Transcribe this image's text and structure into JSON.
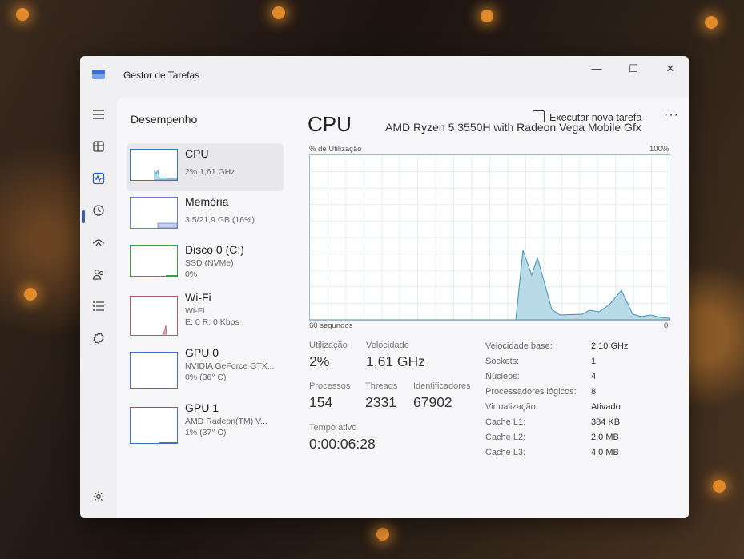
{
  "window": {
    "title": "Gestor de Tarefas",
    "controls": {
      "minimize": "—",
      "maximize": "☐",
      "close": "✕"
    }
  },
  "toolbar": {
    "page_title": "Desempenho",
    "run_task": "Executar nova tarefa",
    "more": "···"
  },
  "rail": {
    "icons": [
      "menu-icon",
      "processes-icon",
      "performance-icon",
      "app-history-icon",
      "startup-apps-icon",
      "users-icon",
      "details-icon",
      "services-icon",
      "settings-icon"
    ],
    "selected": "performance-icon"
  },
  "list": {
    "items": [
      {
        "name": "CPU",
        "lines": [
          "2% 1,61 GHz"
        ]
      },
      {
        "name": "Memória",
        "lines": [
          "3,5/21,9 GB (16%)"
        ]
      },
      {
        "name": "Disco 0 (C:)",
        "lines": [
          "SSD (NVMe)",
          "0%"
        ]
      },
      {
        "name": "Wi-Fi",
        "lines": [
          "Wi-Fi",
          "E: 0 R: 0 Kbps"
        ]
      },
      {
        "name": "GPU 0",
        "lines": [
          "NVIDIA GeForce GTX...",
          "0% (36° C)"
        ]
      },
      {
        "name": "GPU 1",
        "lines": [
          "AMD Radeon(TM) V...",
          "1% (37° C)"
        ]
      }
    ],
    "selected": "CPU"
  },
  "detail": {
    "title": "CPU",
    "model": "AMD Ryzen 5 3550H with Radeon Vega Mobile Gfx",
    "graph": {
      "y_label": "% de Utilização",
      "y_max_label": "100%",
      "x_left_label": "60 segundos",
      "x_right_label": "0",
      "colors": {
        "fill": "#b9dbe8",
        "line": "#3d90b8",
        "grid": "#e3edf3"
      }
    },
    "stats": {
      "utilization": {
        "label": "Utilização",
        "value": "2%"
      },
      "speed": {
        "label": "Velocidade",
        "value": "1,61 GHz"
      },
      "processes": {
        "label": "Processos",
        "value": "154"
      },
      "threads": {
        "label": "Threads",
        "value": "2331"
      },
      "handles": {
        "label": "Identificadores",
        "value": "67902"
      },
      "uptime": {
        "label": "Tempo ativo",
        "value": "0:00:06:28"
      }
    },
    "specs": [
      {
        "label": "Velocidade base:",
        "value": "2,10 GHz"
      },
      {
        "label": "Sockets:",
        "value": "1"
      },
      {
        "label": "Núcleos:",
        "value": "4"
      },
      {
        "label": "Processadores lógicos:",
        "value": "8"
      },
      {
        "label": "Virtualização:",
        "value": "Ativado"
      },
      {
        "label": "Cache L1:",
        "value": "384 KB"
      },
      {
        "label": "Cache L2:",
        "value": "2,0 MB"
      },
      {
        "label": "Cache L3:",
        "value": "4,0 MB"
      }
    ]
  }
}
